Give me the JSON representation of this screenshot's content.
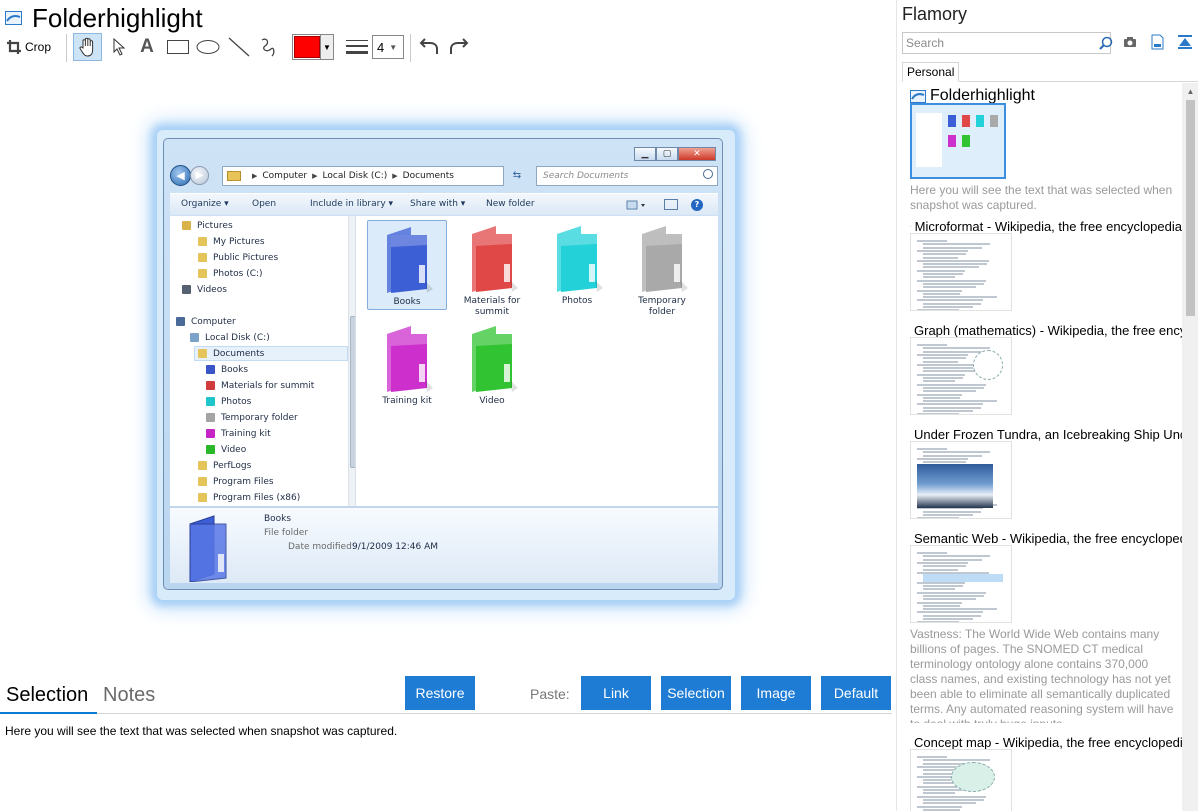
{
  "app": {
    "title": "Folderhighlight"
  },
  "toolbar": {
    "crop_label": "Crop",
    "text_tool_glyph": "A",
    "line_width": "4",
    "stroke_color": "#ff0000"
  },
  "explorer": {
    "breadcrumb": [
      "Computer",
      "Local Disk (C:)",
      "Documents"
    ],
    "search_placeholder": "Search Documents",
    "commands": {
      "organize": "Organize ▾",
      "open": "Open",
      "include": "Include in library ▾",
      "share": "Share with ▾",
      "new_folder": "New folder"
    },
    "tree": [
      {
        "label": "Pictures",
        "color": "#d9b24a"
      },
      {
        "label": "My Pictures",
        "color": "#e6c45c"
      },
      {
        "label": "Public Pictures",
        "color": "#e6c45c"
      },
      {
        "label": "Photos (C:)",
        "color": "#e6c45c"
      },
      {
        "label": "Videos",
        "color": "#556070"
      },
      {
        "label": "Computer",
        "color": "#4a6a9a"
      },
      {
        "label": "Local Disk (C:)",
        "color": "#7ba2c8"
      },
      {
        "label": "Documents",
        "color": "#e6c45c"
      },
      {
        "label": "Books",
        "color": "#3a55c8"
      },
      {
        "label": "Materials for summit",
        "color": "#d03c3c"
      },
      {
        "label": "Photos",
        "color": "#1ec6cc"
      },
      {
        "label": "Temporary folder",
        "color": "#a4a4a4"
      },
      {
        "label": "Training kit",
        "color": "#c425c4"
      },
      {
        "label": "Video",
        "color": "#2ab82a"
      },
      {
        "label": "PerfLogs",
        "color": "#e6c45c"
      },
      {
        "label": "Program Files",
        "color": "#e6c45c"
      },
      {
        "label": "Program Files (x86)",
        "color": "#e6c45c"
      }
    ],
    "files": [
      {
        "label": "Books",
        "color": "#3d5fd6"
      },
      {
        "label": "Materials for summit",
        "color": "#e04848"
      },
      {
        "label": "Photos",
        "color": "#22d2d8"
      },
      {
        "label": "Temporary folder",
        "color": "#a9a9a9"
      },
      {
        "label": "Training kit",
        "color": "#cc2fcc"
      },
      {
        "label": "Video",
        "color": "#32c332"
      }
    ],
    "details": {
      "name": "Books",
      "type": "File folder",
      "date_label": "Date modified:",
      "date": "9/1/2009 12:46 AM"
    }
  },
  "bottom": {
    "tab_selection": "Selection",
    "tab_notes": "Notes",
    "restore": "Restore",
    "paste_label": "Paste:",
    "link": "Link",
    "selection": "Selection",
    "image": "Image",
    "default": "Default",
    "selection_text": "Here you will see the text that was selected when snapshot was captured."
  },
  "sidebar": {
    "title": "Flamory",
    "search_placeholder": "Search",
    "tab_personal": "Personal",
    "entries": [
      {
        "title": "Folderhighlight",
        "desc": "Here you will see the text that was selected when snapshot was captured."
      },
      {
        "title": "Microformat - Wikipedia, the free encyclopedia",
        "desc": ""
      },
      {
        "title": "Graph (mathematics) - Wikipedia, the free encyclopedia",
        "desc": ""
      },
      {
        "title": "Under Frozen Tundra, an Icebreaking Ship Uncovers",
        "desc": ""
      },
      {
        "title": "Semantic Web - Wikipedia, the free encyclopedia",
        "desc": "Vastness: The World Wide Web contains many billions of pages. The SNOMED CT medical terminology ontology alone contains 370,000 class names, and existing technology has not yet been able to eliminate all semantically duplicated terms. Any automated reasoning system will have to deal with truly huge inputs."
      },
      {
        "title": "Concept map - Wikipedia, the free encyclopedia",
        "desc": ""
      }
    ]
  }
}
